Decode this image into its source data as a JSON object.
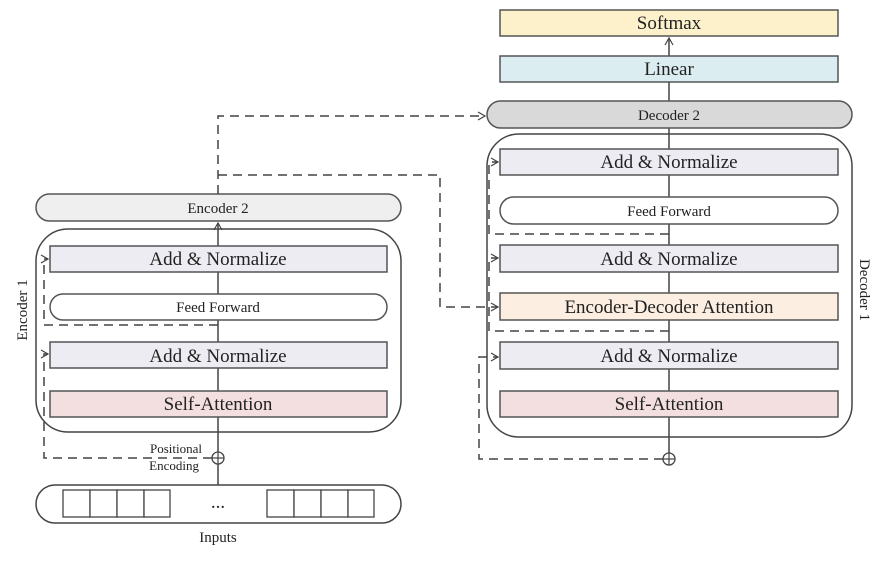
{
  "colors": {
    "softmax": "#fdf1cc",
    "linear": "#dcedf2",
    "decoder2": "#d9d9d9",
    "encoder2": "#efefef",
    "add_normalize": "#ececf2",
    "self_attention": "#f3dfdf",
    "encoder_decoder_attention": "#fcefe2",
    "feed_forward": "#ffffff"
  },
  "decoder": {
    "softmax": "Softmax",
    "linear": "Linear",
    "decoder2": "Decoder 2",
    "label": "Decoder 1",
    "layers": {
      "add_norm_top": "Add & Normalize",
      "feed_forward": "Feed Forward",
      "add_norm_mid": "Add & Normalize",
      "enc_dec_attention": "Encoder-Decoder Attention",
      "add_norm_bottom": "Add & Normalize",
      "self_attention": "Self-Attention"
    }
  },
  "encoder": {
    "encoder2": "Encoder 2",
    "label": "Encoder 1",
    "layers": {
      "add_norm_top": "Add & Normalize",
      "feed_forward": "Feed Forward",
      "add_norm_bottom": "Add & Normalize",
      "self_attention": "Self-Attention"
    },
    "positional_line1": "Positional",
    "positional_line2": "Encoding",
    "ellipsis": "...",
    "inputs": "Inputs"
  }
}
